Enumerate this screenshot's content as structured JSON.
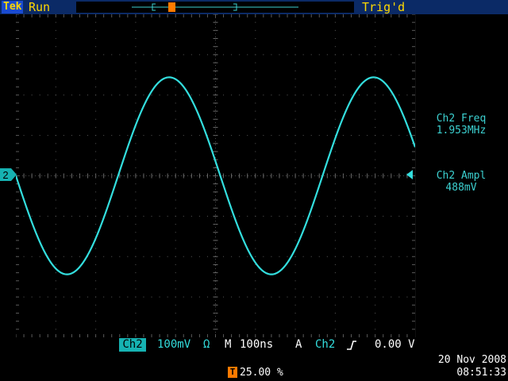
{
  "header": {
    "brand": "Tek",
    "acq_state": "Run",
    "trigger_status": "Trig'd"
  },
  "trigger_marker": "T",
  "channel_marker": "2",
  "measurements": [
    {
      "label": "Ch2 Freq",
      "value": "1.953MHz"
    },
    {
      "label": "Ch2 Ampl",
      "value": "488mV"
    }
  ],
  "status_bar": {
    "channel": "Ch2",
    "volts_per_div": "100mV",
    "impedance": "Ω",
    "timebase_label": "M",
    "time_per_div": "100ns",
    "trigger_label": "A",
    "trigger_source": "Ch2",
    "trigger_slope_icon": "rising-edge",
    "trigger_level": "0.00 V"
  },
  "trigger_position": {
    "badge": "T",
    "value": "25.00 %"
  },
  "timestamp": {
    "date": "20 Nov 2008",
    "time": "08:51:33"
  },
  "colors": {
    "trace": "#33dede",
    "accent": "#ffd800",
    "trigger": "#ff7a00",
    "status_bar": "#0b2a66"
  },
  "waveform": {
    "channel": "Ch2",
    "shape": "sine",
    "frequency": "1.953MHz",
    "amplitude": "488mV"
  }
}
